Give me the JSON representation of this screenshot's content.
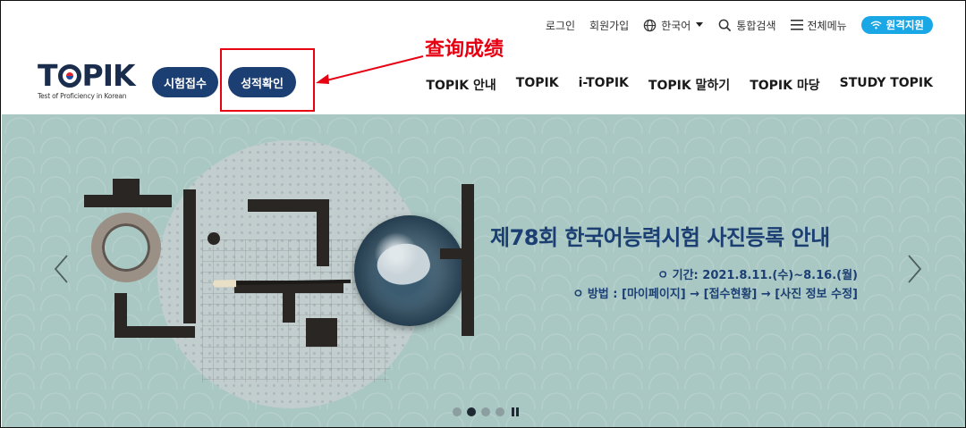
{
  "util": {
    "login": "로그인",
    "signup": "회원가입",
    "language": "한국어",
    "search": "통합검색",
    "menu": "전체메뉴",
    "remote": "원격지원"
  },
  "logo": {
    "tagline": "Test of Proficiency in Korean"
  },
  "header": {
    "apply_label": "시험접수",
    "result_label": "성적확인"
  },
  "annotation": {
    "text": "查询成绩",
    "color": "#e60012"
  },
  "gnb": {
    "items": [
      {
        "label": "TOPIK 안내"
      },
      {
        "label": "TOPIK"
      },
      {
        "label": "i-TOPIK"
      },
      {
        "label": "TOPIK 말하기"
      },
      {
        "label": "TOPIK 마당"
      },
      {
        "label": "STUDY TOPIK"
      }
    ]
  },
  "banner": {
    "title": "제78회 한국어능력시험 사진등록 안내",
    "line1": "ㅇ 기간: 2021.8.11.(수)~8.16.(월)",
    "line2": "ㅇ 방법 : [마이페이지] → [접수현황] → [사진 정보 수정]",
    "slides_total": 4,
    "current_slide": 2
  },
  "colors": {
    "navy": "#1b3f73",
    "remote_bg": "#1aa7e6",
    "banner_bg": "#a9c7c3"
  }
}
